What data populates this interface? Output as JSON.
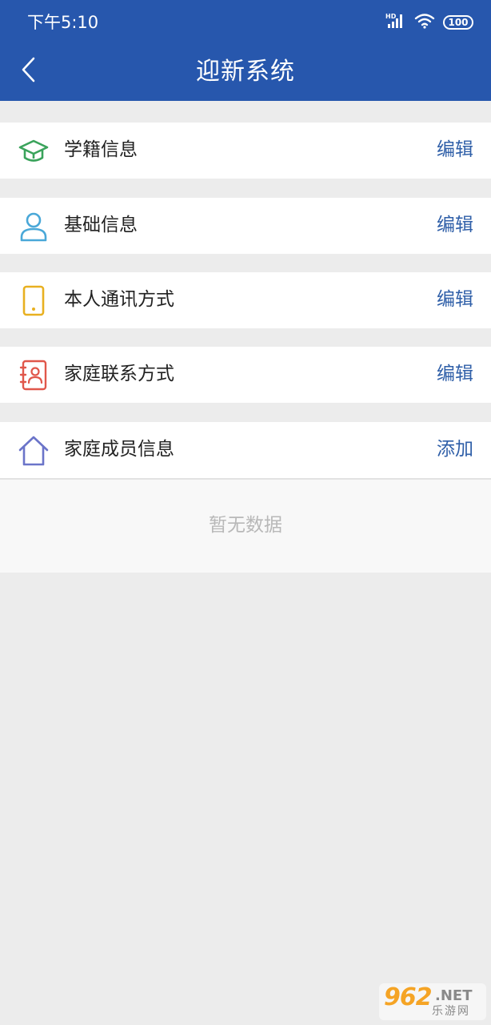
{
  "status_bar": {
    "time": "下午5:10",
    "battery": "100",
    "icons": [
      "hd-signal-icon",
      "wifi-icon",
      "battery-icon"
    ]
  },
  "nav": {
    "title": "迎新系统",
    "back_icon": "chevron-left-icon"
  },
  "sections": [
    {
      "label": "学籍信息",
      "action": "编辑",
      "icon": "graduation-cap-icon",
      "icon_color": "#3aa35b"
    },
    {
      "label": "基础信息",
      "action": "编辑",
      "icon": "person-icon",
      "icon_color": "#4aa8d8"
    },
    {
      "label": "本人通讯方式",
      "action": "编辑",
      "icon": "phone-icon",
      "icon_color": "#e8b020"
    },
    {
      "label": "家庭联系方式",
      "action": "编辑",
      "icon": "contact-card-icon",
      "icon_color": "#e0574b"
    },
    {
      "label": "家庭成员信息",
      "action": "添加",
      "icon": "home-icon",
      "icon_color": "#6b74c9"
    }
  ],
  "family_members": {
    "empty_text": "暂无数据"
  },
  "colors": {
    "header_bg": "#2757ad",
    "page_bg": "#ececec",
    "action_text": "#2f5fa8"
  },
  "watermark": {
    "logo": "962",
    "domain": ".NET",
    "sub": "乐游网"
  }
}
